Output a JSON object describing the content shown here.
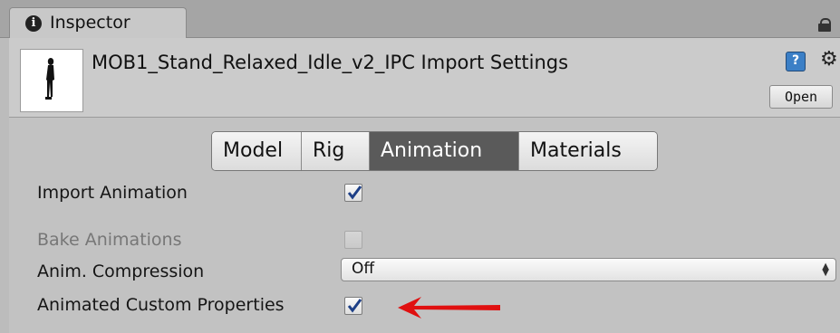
{
  "inspector": {
    "tab_label": "Inspector",
    "info_icon": "i"
  },
  "header": {
    "title": "MOB1_Stand_Relaxed_Idle_v2_IPC Import Settings",
    "open_label": "Open",
    "help_icon": "?",
    "gear_icon": "⚙"
  },
  "tabs": [
    {
      "label": "Model",
      "active": false
    },
    {
      "label": "Rig",
      "active": false
    },
    {
      "label": "Animation",
      "active": true
    },
    {
      "label": "Materials",
      "active": false
    }
  ],
  "settings": {
    "import_animation": {
      "label": "Import Animation",
      "checked": true
    },
    "bake_animations": {
      "label": "Bake Animations",
      "checked": false,
      "disabled": true
    },
    "anim_compression": {
      "label": "Anim. Compression",
      "value": "Off"
    },
    "animated_custom_properties": {
      "label": "Animated Custom Properties",
      "checked": true
    }
  },
  "colors": {
    "active_tab": "#5a5a5a",
    "annotation_arrow": "#e01010",
    "help_icon": "#3b7fc6"
  }
}
